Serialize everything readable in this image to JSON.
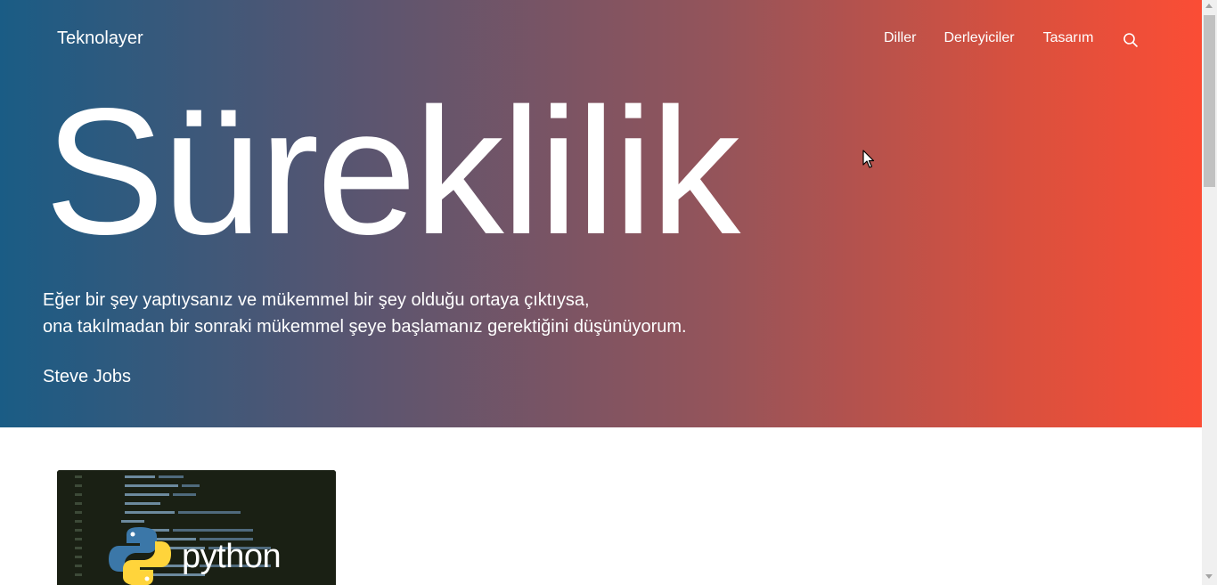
{
  "header": {
    "brand": "Teknolayer",
    "nav": [
      "Diller",
      "Derleyiciler",
      "Tasarım"
    ],
    "search_icon": "search-icon"
  },
  "hero": {
    "headline": "Süreklilik",
    "quote_line1": "Eğer bir şey yaptıysanız ve mükemmel bir şey olduğu ortaya çıktıysa,",
    "quote_line2": "ona takılmadan bir sonraki mükemmel şeye başlamanız gerektiğini düşünüyorum.",
    "author": "Steve Jobs"
  },
  "post_card": {
    "image_label": "python",
    "image_icon": "python-logo-icon"
  },
  "colors": {
    "gradient_start": "#1a5c85",
    "gradient_end": "#fb4d35",
    "card_bg": "#1c2214"
  }
}
